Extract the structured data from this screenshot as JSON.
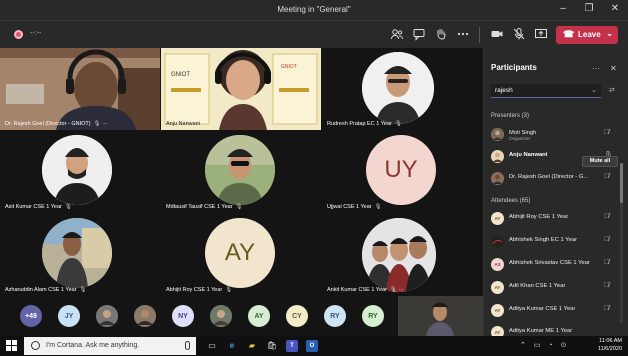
{
  "window": {
    "title": "Meeting in \"General\"",
    "minimize": "–",
    "maximize": "❐",
    "close": "✕"
  },
  "toolbar": {
    "timer": "--:--",
    "leave_label": "Leave",
    "leave_color": "#c4314b",
    "icons": [
      "participants-icon",
      "chat-icon",
      "raise-hand-icon",
      "more-icon",
      "camera-icon",
      "mic-off-icon",
      "share-icon"
    ]
  },
  "tiles": [
    {
      "name": "Dr. Rajesh Goel (Director - GNIOT)"
    },
    {
      "name": "Anju Nanwani"
    },
    {
      "name": "Rudresh Pratap EC 1 Year"
    },
    {
      "name": "Asit Kumar CSE 1 Year"
    },
    {
      "name": "Mdtausif Tausif CSE 1 Year"
    },
    {
      "name": "Ujjwal CSE 1 Year",
      "initials": "UY",
      "color": "#f3d6cf",
      "text_color": "#8a3b2e"
    },
    {
      "name": "Azharuddin Alam CSE 1 Year"
    },
    {
      "name": "Abhijit Roy CSE 1 Year",
      "initials": "AY",
      "color": "#f1e6cd",
      "text_color": "#6b5a20"
    },
    {
      "name": "Ankit Kumar CSE 1 Year"
    }
  ],
  "strip": {
    "overflow": "+49",
    "avatars": [
      {
        "initials": "JY",
        "color": "#c9e1f5",
        "text": "#2b5b84"
      },
      {
        "initials": "",
        "color": "#6a6a6a",
        "text": "#fff"
      },
      {
        "initials": "",
        "color": "#8a6b55",
        "text": "#fff"
      },
      {
        "initials": "NY",
        "color": "#dfe0f7",
        "text": "#3d3f8a"
      },
      {
        "initials": "",
        "color": "#7c7c7c",
        "text": "#fff"
      },
      {
        "initials": "AY",
        "color": "#d7ecd3",
        "text": "#2e6b2a"
      },
      {
        "initials": "CY",
        "color": "#f3eccb",
        "text": "#6b5a20"
      },
      {
        "initials": "RY",
        "color": "#cfe3f3",
        "text": "#2b5b84"
      },
      {
        "initials": "RY",
        "color": "#d5efd0",
        "text": "#2e6b2a"
      }
    ]
  },
  "panel": {
    "title": "Participants",
    "search_value": "rajesh",
    "presenters_header": "Presenters (3)",
    "mute_all": "Mute all",
    "attendees_header": "Attendees (65)",
    "presenters": [
      {
        "name": "Moti Singh",
        "role": "Organizer",
        "initials": "",
        "color": "#8a8a8a",
        "text": "#fff"
      },
      {
        "name": "Anju Nanwani",
        "role": "",
        "initials": "",
        "color": "#b08a78",
        "text": "#fff",
        "bold": true
      },
      {
        "name": "Dr. Rajesh Goel (Director - G...",
        "role": "",
        "initials": "",
        "color": "#5a5a5a",
        "text": "#fff"
      }
    ],
    "attendees": [
      {
        "name": "Abhijit Roy CSE 1 Year",
        "initials": "AY",
        "color": "#f1e6cd",
        "text": "#6b5a20"
      },
      {
        "name": "Abhishek Singh EC 1 Year",
        "initials": "",
        "color": "#444",
        "text": "#fff"
      },
      {
        "name": "Abhishek Srivastav CSE 1 Year",
        "initials": "AS",
        "color": "#f3d6cf",
        "text": "#8a3b2e"
      },
      {
        "name": "Adil Khan CSE 1 Year",
        "initials": "AY",
        "color": "#f1e6cd",
        "text": "#6b5a20"
      },
      {
        "name": "Aditya Kumar CSE 1 Year",
        "initials": "AY",
        "color": "#f1e6cd",
        "text": "#6b5a20"
      },
      {
        "name": "Aditya Kumar ME 1 Year",
        "initials": "AY",
        "color": "#f1e6cd",
        "text": "#6b5a20"
      }
    ]
  },
  "taskbar": {
    "cortana_placeholder": "I'm Cortana. Ask me anything.",
    "time": "11:06 AM",
    "date": "11/6/2020"
  }
}
